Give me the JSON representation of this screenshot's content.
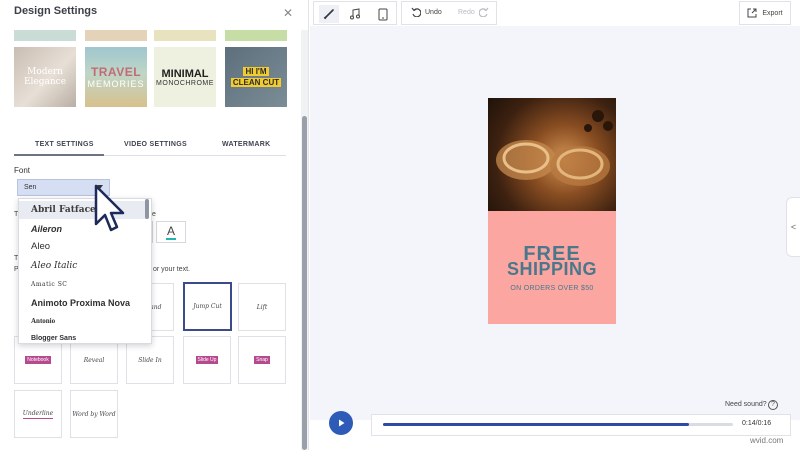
{
  "panel": {
    "title": "Design Settings",
    "close_icon": "close-icon",
    "styles": [
      {
        "line1": "Modern",
        "line2": "Elegance"
      },
      {
        "line1": "TRAVEL",
        "line2": "MEMORIES"
      },
      {
        "line1": "MINIMAL",
        "line2": "MONOCHROME"
      },
      {
        "line1": "HI I'M",
        "line2": "CLEAN CUT"
      }
    ],
    "top_row_colors": [
      "#c9dcd6",
      "#e4d3b8",
      "#e8e2bf",
      "#c6dea5"
    ],
    "tabs": [
      {
        "label": "TEXT SETTINGS",
        "active": true
      },
      {
        "label": "VIDEO SETTINGS",
        "active": false
      },
      {
        "label": "WATERMARK",
        "active": false
      }
    ],
    "font_label": "Font",
    "font_value": "Sen",
    "partial_texts": {
      "t1": "T",
      "e": "e",
      "t2": "T",
      "p": "P",
      "for_your_text": "or your text."
    },
    "color_button_glyph": "A",
    "color_accent": "#22b5b0",
    "animations": [
      {
        "label": "Expand",
        "style": "plain"
      },
      {
        "label": "Jump Cut",
        "style": "plain",
        "selected": true
      },
      {
        "label": "Lift",
        "style": "plain"
      },
      {
        "label": "Notebook",
        "style": "pill"
      },
      {
        "label": "Reveal",
        "style": "plain"
      },
      {
        "label": "Slide In",
        "style": "plain"
      },
      {
        "label": "Slide Up",
        "style": "pill"
      },
      {
        "label": "Snap",
        "style": "pill"
      },
      {
        "label": "Underline",
        "style": "under"
      },
      {
        "label": "Word by Word",
        "style": "plain"
      }
    ]
  },
  "font_dropdown": {
    "items": [
      "Abril Fatface",
      "Aileron",
      "Aleo",
      "Aleo Italic",
      "Amatic SC",
      "Animoto Proxima Nova",
      "Antonio",
      "Blogger Sans"
    ],
    "highlighted_index": 0
  },
  "toolbar": {
    "undo_label": "Undo",
    "redo_label": "Redo",
    "export_label": "Export",
    "tools": [
      "pen-icon",
      "music-icon",
      "phone-icon"
    ]
  },
  "preview": {
    "headline_1": "FREE",
    "headline_2": "SHIPPING",
    "subline": "ON ORDERS OVER $50",
    "text_color": "#49788c",
    "background_color": "#fba6a1"
  },
  "side_handle_glyph": "<",
  "player": {
    "need_sound": "Need sound?",
    "help_glyph": "?",
    "time": "0:14/0:16",
    "progress": 0.875
  },
  "watermark": "wvid.com",
  "colors": {
    "accent": "#2e5ab8",
    "panel_border": "#e2e4ea"
  }
}
